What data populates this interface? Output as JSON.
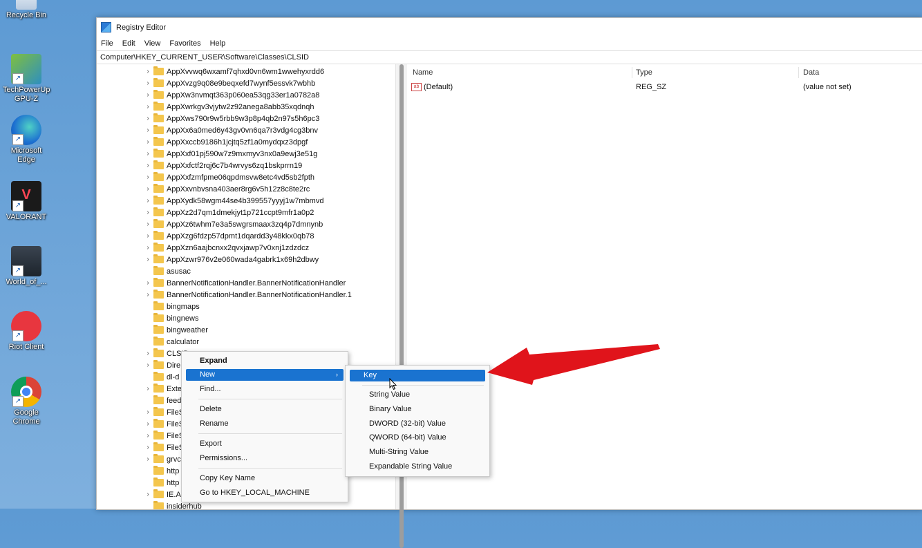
{
  "desktop": {
    "icons": [
      {
        "label": "Recycle Bin",
        "icon": "recycle-bin-icon"
      },
      {
        "label": "TechPowerUp GPU-Z",
        "icon": "gpu-z-icon"
      },
      {
        "label": "Microsoft Edge",
        "icon": "edge-icon"
      },
      {
        "label": "VALORANT",
        "icon": "valorant-icon"
      },
      {
        "label": "World_of_...",
        "icon": "world-of-warships-icon"
      },
      {
        "label": "Riot Client",
        "icon": "riot-client-icon"
      },
      {
        "label": "Google Chrome",
        "icon": "chrome-icon"
      }
    ]
  },
  "window": {
    "title": "Registry Editor",
    "menu": [
      "File",
      "Edit",
      "View",
      "Favorites",
      "Help"
    ],
    "address": "Computer\\HKEY_CURRENT_USER\\Software\\Classes\\CLSID"
  },
  "tree": {
    "items": [
      {
        "label": "AppXvvwq6wxamf7qhxd0vn6wm1wwehyxrdd6",
        "expandable": true
      },
      {
        "label": "AppXvzg9q08e9beqxefd7wynf5essvk7wbhb",
        "expandable": true
      },
      {
        "label": "AppXw3nvmqt363p060ea53qg33er1a0782a8",
        "expandable": true
      },
      {
        "label": "AppXwrkgv3vjytw2z92anega8abb35xqdnqh",
        "expandable": true
      },
      {
        "label": "AppXws790r9w5rbb9w3p8p4qb2n97s5h6pc3",
        "expandable": true
      },
      {
        "label": "AppXx6a0med6y43gv0vn6qa7r3vdg4cg3bnv",
        "expandable": true
      },
      {
        "label": "AppXxccb9186h1jcjtq5zf1a0mydqxz3dpgf",
        "expandable": true
      },
      {
        "label": "AppXxf01pj590w7z9mxmyv3nx0a9ewj3e51g",
        "expandable": true
      },
      {
        "label": "AppXxfctf2rqj6c7b4wrvys6zq1bskprrn19",
        "expandable": true
      },
      {
        "label": "AppXxfzmfpme06qpdmsvw8etc4vd5sb2fpth",
        "expandable": true
      },
      {
        "label": "AppXxvnbvsna403aer8rg6v5h12z8c8te2rc",
        "expandable": true
      },
      {
        "label": "AppXydk58wgm44se4b399557yyyj1w7mbmvd",
        "expandable": true
      },
      {
        "label": "AppXz2d7qm1dmekjyt1p721ccpt9mfr1a0p2",
        "expandable": true
      },
      {
        "label": "AppXz6twhm7e3a5swgrsmaax3zq4p7dmnynb",
        "expandable": true
      },
      {
        "label": "AppXzg6fdzp57dpmt1dqardd3y48kkx0qb78",
        "expandable": true
      },
      {
        "label": "AppXzn6aajbcnxx2qvxjawp7v0xnj1zdzdcz",
        "expandable": true
      },
      {
        "label": "AppXzwr976v2e060wada4gabrk1x69h2dbwy",
        "expandable": true
      },
      {
        "label": "asusac",
        "expandable": false
      },
      {
        "label": "BannerNotificationHandler.BannerNotificationHandler",
        "expandable": true
      },
      {
        "label": "BannerNotificationHandler.BannerNotificationHandler.1",
        "expandable": true
      },
      {
        "label": "bingmaps",
        "expandable": false
      },
      {
        "label": "bingnews",
        "expandable": false
      },
      {
        "label": "bingweather",
        "expandable": false
      },
      {
        "label": "calculator",
        "expandable": false
      },
      {
        "label": "CLSID",
        "expandable": true
      },
      {
        "label": "Dire",
        "expandable": true
      },
      {
        "label": "dl-d",
        "expandable": false
      },
      {
        "label": "Exte",
        "expandable": true
      },
      {
        "label": "feed",
        "expandable": false
      },
      {
        "label": "FileS",
        "expandable": true
      },
      {
        "label": "FileS",
        "expandable": true
      },
      {
        "label": "FileS",
        "expandable": true
      },
      {
        "label": "FileS",
        "expandable": true
      },
      {
        "label": "grvc",
        "expandable": true
      },
      {
        "label": "http",
        "expandable": false
      },
      {
        "label": "http",
        "expandable": false
      },
      {
        "label": "IE.As",
        "expandable": true
      },
      {
        "label": "insiderhub",
        "expandable": false
      }
    ]
  },
  "list": {
    "headers": {
      "name": "Name",
      "type": "Type",
      "data": "Data"
    },
    "rows": [
      {
        "name": "(Default)",
        "type": "REG_SZ",
        "data": "(value not set)"
      }
    ]
  },
  "context_menu": {
    "items": [
      "Expand",
      "New",
      "Find...",
      "Delete",
      "Rename",
      "Export",
      "Permissions...",
      "Copy Key Name",
      "Go to HKEY_LOCAL_MACHINE"
    ]
  },
  "submenu": {
    "items": [
      "Key",
      "String Value",
      "Binary Value",
      "DWORD (32-bit) Value",
      "QWORD (64-bit) Value",
      "Multi-String Value",
      "Expandable String Value"
    ]
  },
  "colors": {
    "selection": "#1a73d0",
    "annotation_arrow": "#e0141b",
    "folder": "#f4c64d"
  }
}
